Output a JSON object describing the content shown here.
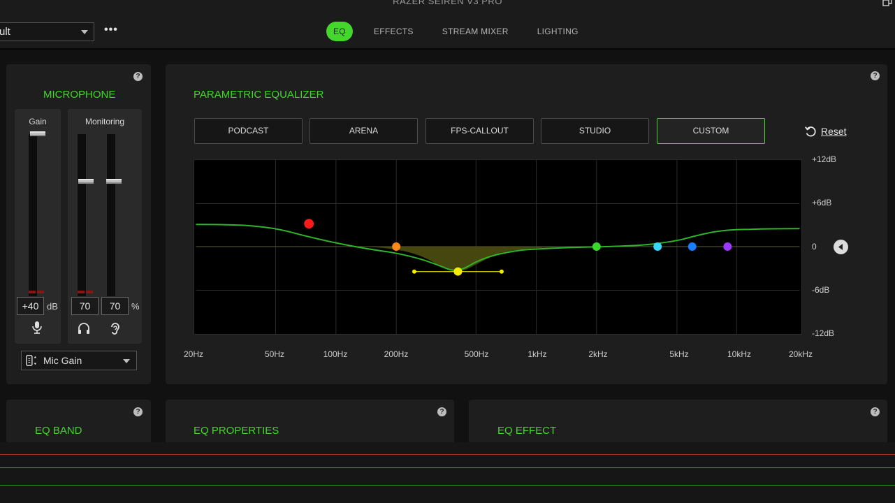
{
  "app": {
    "title": "RAZER SEIREN V3 PRO"
  },
  "header": {
    "profile_value": "ult",
    "more_icon": "more-horizontal-icon",
    "tabs": [
      {
        "label": "EQ",
        "active": true
      },
      {
        "label": "EFFECTS",
        "active": false
      },
      {
        "label": "STREAM MIXER",
        "active": false
      },
      {
        "label": "LIGHTING",
        "active": false
      }
    ]
  },
  "microphone": {
    "title": "MICROPHONE",
    "gain": {
      "label": "Gain",
      "value": "+40",
      "unit": "dB",
      "icon": "microphone-icon"
    },
    "monitoring": {
      "label": "Monitoring",
      "headphones_value": "70",
      "sidetone_value": "70",
      "unit": "%",
      "icons": [
        "headphones-icon",
        "ear-icon"
      ]
    },
    "gain_select": {
      "label": "Mic Gain",
      "icon": "mic-gain-icon"
    }
  },
  "param_eq": {
    "title": "PARAMETRIC EQUALIZER",
    "presets": [
      {
        "label": "PODCAST",
        "active": false
      },
      {
        "label": "ARENA",
        "active": false
      },
      {
        "label": "FPS-CALLOUT",
        "active": false
      },
      {
        "label": "STUDIO",
        "active": false
      },
      {
        "label": "CUSTOM",
        "active": true
      }
    ],
    "reset_label": "Reset",
    "db_labels": [
      "+12dB",
      "+6dB",
      "0",
      "-6dB",
      "-12dB"
    ],
    "freq_labels": [
      "20Hz",
      "50Hz",
      "100Hz",
      "200Hz",
      "500Hz",
      "1kHz",
      "2kHz",
      "5kHz",
      "10kHz",
      "20kHz"
    ],
    "colors": {
      "accent": "#44d62c",
      "curve": "#2fb52a"
    }
  },
  "bottom": {
    "eq_band_title": "EQ BAND",
    "eq_properties_title": "EQ PROPERTIES",
    "eq_effect_title": "EQ EFFECT"
  }
}
